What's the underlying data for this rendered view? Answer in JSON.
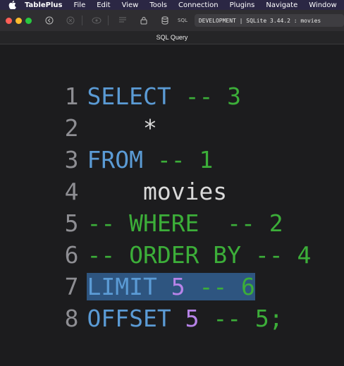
{
  "menubar": {
    "app_name": "TablePlus",
    "items": [
      "File",
      "Edit",
      "View",
      "Tools",
      "Connection",
      "Plugins",
      "Navigate",
      "Window"
    ]
  },
  "toolbar": {
    "sql_label": "SQL",
    "connection_label": "DEVELOPMENT | SQLite 3.44.2 : movies"
  },
  "tab": {
    "title": "SQL Query"
  },
  "editor": {
    "lines": [
      {
        "number": "1",
        "tokens": [
          {
            "text": "SELECT",
            "kind": "kw"
          },
          {
            "text": " ",
            "kind": "plain"
          },
          {
            "text": "-- 3",
            "kind": "cm"
          }
        ]
      },
      {
        "number": "2",
        "tokens": [
          {
            "text": "    *",
            "kind": "plain"
          }
        ]
      },
      {
        "number": "3",
        "tokens": [
          {
            "text": "FROM",
            "kind": "kw"
          },
          {
            "text": " ",
            "kind": "plain"
          },
          {
            "text": "-- 1",
            "kind": "cm"
          }
        ]
      },
      {
        "number": "4",
        "tokens": [
          {
            "text": "    movies",
            "kind": "plain"
          }
        ]
      },
      {
        "number": "5",
        "tokens": [
          {
            "text": "-- WHERE  -- 2",
            "kind": "cm"
          }
        ]
      },
      {
        "number": "6",
        "tokens": [
          {
            "text": "-- ORDER BY -- 4",
            "kind": "cm"
          }
        ]
      },
      {
        "number": "7",
        "selected": true,
        "tokens": [
          {
            "text": "LIMIT",
            "kind": "kw"
          },
          {
            "text": " ",
            "kind": "plain"
          },
          {
            "text": "5",
            "kind": "num"
          },
          {
            "text": " ",
            "kind": "plain"
          },
          {
            "text": "-- 6",
            "kind": "cm"
          }
        ]
      },
      {
        "number": "8",
        "tokens": [
          {
            "text": "OFFSET",
            "kind": "kw"
          },
          {
            "text": " ",
            "kind": "plain"
          },
          {
            "text": "5",
            "kind": "num"
          },
          {
            "text": " ",
            "kind": "plain"
          },
          {
            "text": "-- 5;",
            "kind": "cm"
          }
        ]
      }
    ]
  },
  "colors": {
    "keyword": "#5b9bd5",
    "comment": "#3cae39",
    "number": "#b783e8",
    "plain": "#d9d9d9",
    "selection": "#2e5580",
    "background": "#1c1c1e"
  },
  "icons": [
    "apple-icon",
    "back-icon",
    "close-connection-icon",
    "preview-icon",
    "list-icon",
    "lock-icon",
    "database-icon"
  ]
}
